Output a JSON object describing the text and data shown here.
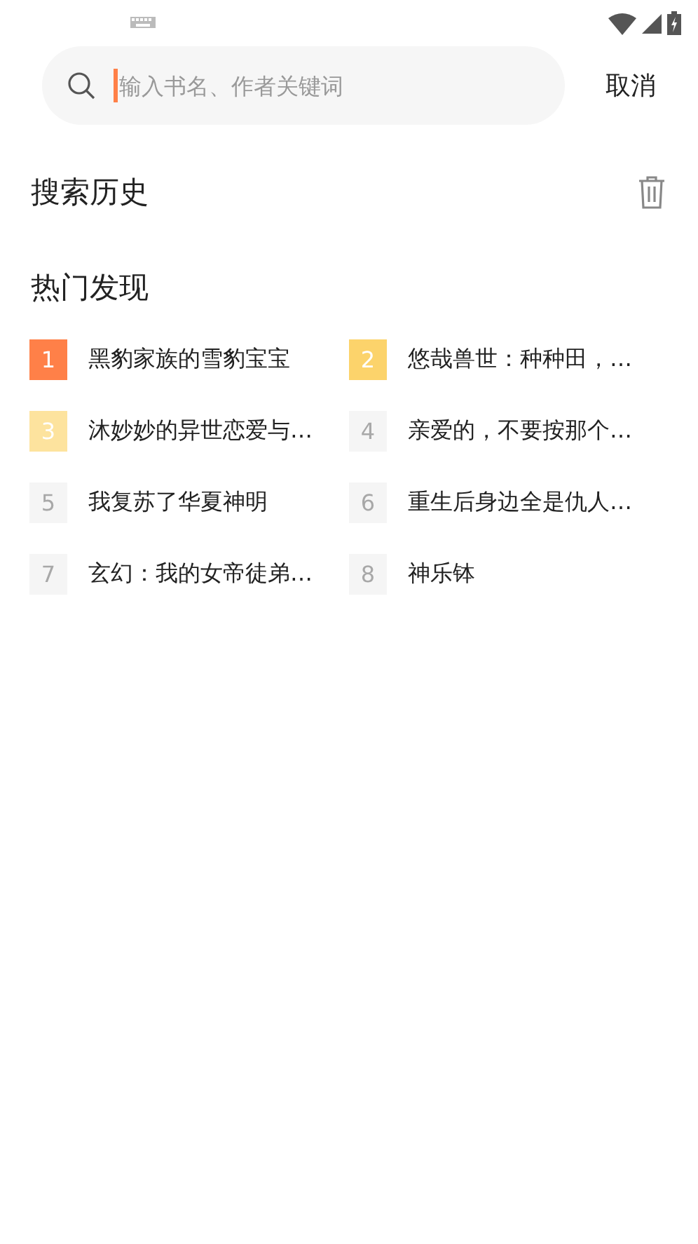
{
  "search": {
    "placeholder": "输入书名、作者关键词",
    "cancel": "取消"
  },
  "history": {
    "title": "搜索历史"
  },
  "hot": {
    "title": "热门发现",
    "items": [
      {
        "rank": "1",
        "title": "黑豹家族的雪豹宝宝",
        "color": "#ff8048"
      },
      {
        "rank": "2",
        "title": "悠哉兽世：种种田，…",
        "color": "#fcd36b"
      },
      {
        "rank": "3",
        "title": "沐妙妙的异世恋爱与…",
        "color": "#fde39e"
      },
      {
        "rank": "4",
        "title": "亲爱的，不要按那个…",
        "color": "#f5f5f5"
      },
      {
        "rank": "5",
        "title": "我复苏了华夏神明",
        "color": "#f5f5f5"
      },
      {
        "rank": "6",
        "title": "重生后身边全是仇人…",
        "color": "#f5f5f5"
      },
      {
        "rank": "7",
        "title": "玄幻：我的女帝徒弟…",
        "color": "#f5f5f5"
      },
      {
        "rank": "8",
        "title": "神乐钵",
        "color": "#f5f5f5"
      }
    ]
  }
}
